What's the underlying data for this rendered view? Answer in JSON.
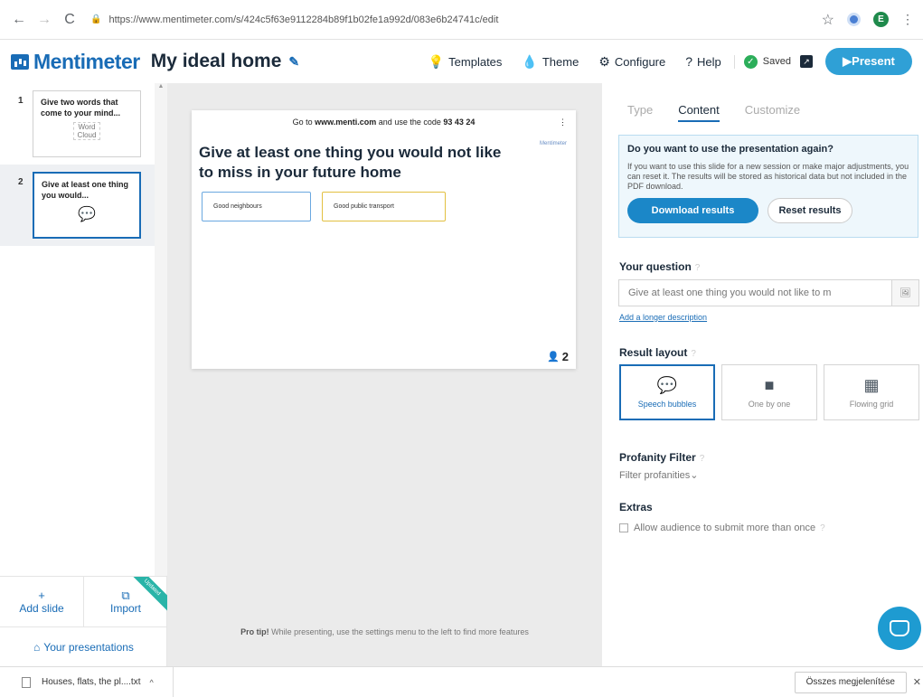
{
  "browser": {
    "url": "https://www.mentimeter.com/s/424c5f63e9112284b89f1b02fe1a992d/083e6b24741c/edit",
    "profile_initial": "E"
  },
  "header": {
    "brand": "Mentimeter",
    "title": "My ideal home",
    "menu": {
      "templates": "Templates",
      "theme": "Theme",
      "configure": "Configure",
      "help": "Help"
    },
    "saved": "Saved",
    "present": "▶Present"
  },
  "sidebar": {
    "slides": [
      {
        "num": "1",
        "text": "Give two words that come to your mind...",
        "thumb": "Word Cloud"
      },
      {
        "num": "2",
        "text": "Give at least one thing you would..."
      }
    ],
    "add_slide": "Add slide",
    "import": "Import",
    "ribbon": "Updated",
    "your_presentations": "Your presentations"
  },
  "canvas": {
    "code_prefix": "Go to",
    "code_site": "www.menti.com",
    "code_mid": "and use the code",
    "code": "93 43 24",
    "brand_small": "Mentimeter",
    "question": "Give at least one thing you would not like to miss in your future home",
    "responses": [
      "Good neighbours",
      "Good public transport"
    ],
    "response_count": "2",
    "protip_bold": "Pro tip!",
    "protip_text": "While presenting, use the settings menu to the left to find more features"
  },
  "panel": {
    "tabs": [
      "Type",
      "Content",
      "Customize"
    ],
    "notice": {
      "title": "Do you want to use the presentation again?",
      "body": "If you want to use this slide for a new session or make major adjustments, you can reset it. The results will be stored as historical data but not included in the PDF download.",
      "download": "Download results",
      "reset": "Reset results"
    },
    "your_question_label": "Your question",
    "question_value": "Give at least one thing you would not like to m",
    "longer_description": "Add a longer description",
    "result_layout_label": "Result layout",
    "layouts": [
      "Speech bubbles",
      "One by one",
      "Flowing grid"
    ],
    "profanity_label": "Profanity Filter",
    "profanity_value": "Filter profanities",
    "extras_label": "Extras",
    "extras_option": "Allow audience to submit more than once"
  },
  "downloads": {
    "file": "Houses, flats, the pl....txt",
    "show_all": "Összes megjelenítése"
  },
  "colors": {
    "brand_blue": "#196cb6",
    "present_blue": "#2fa0d6",
    "saved_green": "#2cae5a",
    "response1_border": "#6aa8e0",
    "response2_border": "#e2c041"
  }
}
